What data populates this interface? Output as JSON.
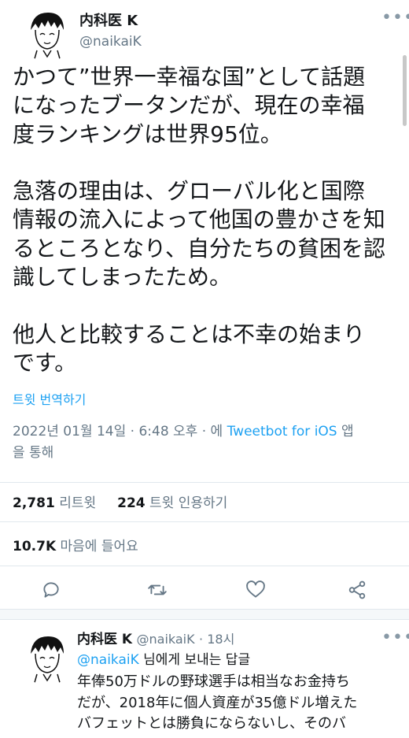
{
  "tweet": {
    "display_name": "内科医 K",
    "handle": "@naikaiK",
    "text": "かつて”世界一幸福な国”として話題\nになったブータンだが、現在の幸福\n度ランキングは世界95位。\n\n急落の理由は、グローバル化と国際\n情報の流入によって他国の豊かさを知\nるところとなり、自分たちの貧困を認\n識してしまったため。\n\n他人と比較することは不幸の始まり\nです。",
    "translate_link": "트윗 번역하기",
    "timestamp_line1_prefix": "2022년 01월 14일 · 6:48 오후 · 에 ",
    "client": "Tweetbot for iOS",
    "timestamp_line1_suffix": " 앱",
    "timestamp_line2": "을 통해",
    "retweet_count": "2,781",
    "retweet_label": "리트윗",
    "quote_count": "224",
    "quote_label": "트윗 인용하기",
    "like_count": "10.7K",
    "like_label": "마음에 들어요"
  },
  "reply": {
    "display_name": "内科医 K",
    "handle": "@naikaiK",
    "time": "· 18시",
    "replying_to": "@naikaiK",
    "replying_suffix": " 님에게 보내는 답글",
    "text": "年俸50万ドルの野球選手は相当なお金持ち\nだが、2018年に個人資産が35億ドル増えた\nバフェットとは勝負にならないし、そのバ"
  },
  "colors": {
    "accent": "#1da1f2",
    "muted": "#657786",
    "text": "#14171a"
  },
  "icons": [
    "reply-icon",
    "retweet-icon",
    "like-icon",
    "share-icon",
    "more-icon"
  ]
}
